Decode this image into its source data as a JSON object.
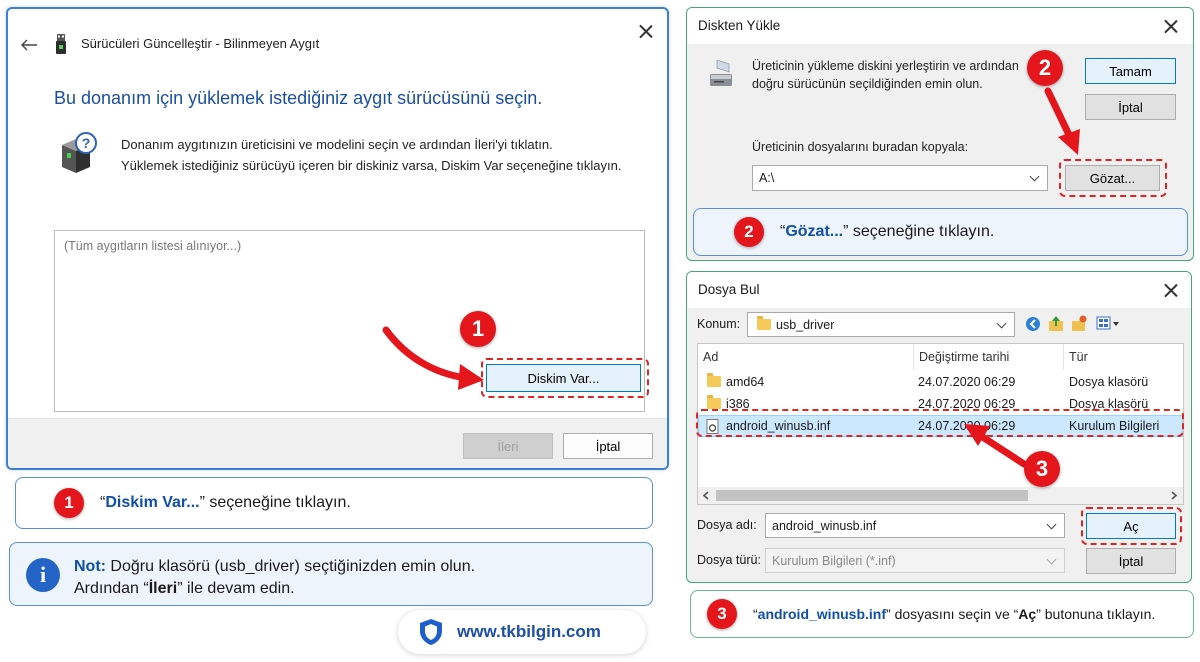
{
  "window1": {
    "title": "Sürücüleri Güncelleştir - Bilinmeyen Aygıt",
    "heading": "Bu donanım için yüklemek istediğiniz aygıt sürücüsünü seçin.",
    "desc_line1": "Donanım aygıtınızın üreticisini ve modelini seçin ve ardından İleri'yi tıklatın.",
    "desc_line2": "Yüklemek istediğiniz sürücüyü içeren bir diskiniz varsa, Diskim Var seçeneğine tıklayın.",
    "list_placeholder": "(Tüm aygıtların listesi alınıyor...)",
    "have_disk_button": "Diskim Var...",
    "next_button": "İleri",
    "cancel_button": "İptal"
  },
  "window2": {
    "title": "Diskten Yükle",
    "desc_line1": "Üreticinin yükleme diskini yerleştirin ve ardından",
    "desc_line2": "doğru sürücünün seçildiğinden emin olun.",
    "ok_button": "Tamam",
    "cancel_button": "İptal",
    "copy_label": "Üreticinin dosyalarını buradan kopyala:",
    "path_value": "A:\\",
    "browse_button": "Gözat..."
  },
  "window3": {
    "title": "Dosya Bul",
    "location_label": "Konum:",
    "location_value": "usb_driver",
    "columns": [
      "Ad",
      "Değiştirme tarihi",
      "Tür"
    ],
    "rows": [
      {
        "name": "amd64",
        "date": "24.07.2020 06:29",
        "type": "Dosya klasörü"
      },
      {
        "name": "i386",
        "date": "24.07.2020 06:29",
        "type": "Dosya klasörü"
      },
      {
        "name": "android_winusb.inf",
        "date": "24.07.2020 06:29",
        "type": "Kurulum Bilgileri"
      }
    ],
    "filename_label": "Dosya adı:",
    "filename_value": "android_winusb.inf",
    "filetype_label": "Dosya türü:",
    "filetype_value": "Kurulum Bilgileri (*.inf)",
    "open_button": "Aç",
    "cancel_button": "İptal"
  },
  "steps": {
    "step1": {
      "number": "1",
      "open_quote": "“",
      "highlight": "Diskim Var...",
      "rest": "” seçeneğine tıklayın."
    },
    "step2": {
      "number": "2",
      "open_quote": "“",
      "highlight": "Gözat...",
      "rest": "” seçeneğine tıklayın."
    },
    "step3": {
      "number": "3",
      "open_quote": "“",
      "highlight": "android_winusb.inf",
      "middle": "” dosyasını seçin ve “",
      "highlight2": "Aç",
      "rest": "” butonuna tıklayın."
    }
  },
  "note": {
    "label": "Not:",
    "line1": " Doğru klasörü (usb_driver) seçtiğinizden emin olun.",
    "line2_a": "Ardından “",
    "line2_bold": "İleri",
    "line2_b": "” ile devam edin."
  },
  "watermark": {
    "url": "www.tkbilgin.com"
  },
  "colors": {
    "accent": "#0f4fa8",
    "red": "#e4161c",
    "window_border_blue": "#3d7fd4",
    "window_border_green": "#41a876",
    "selection": "#cce8ff"
  }
}
